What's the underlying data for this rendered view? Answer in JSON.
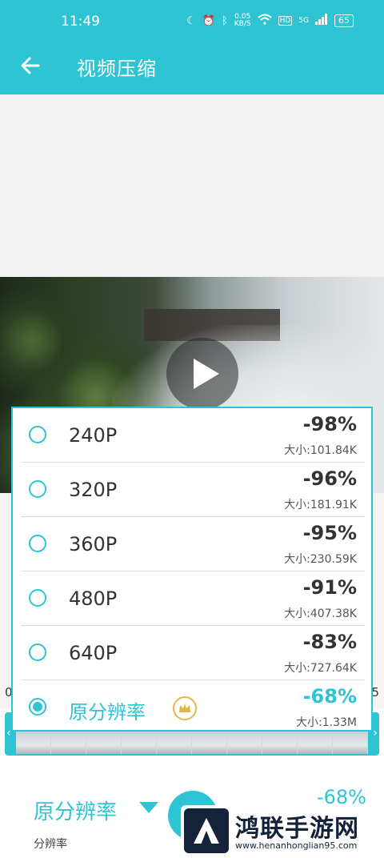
{
  "status_bar": {
    "time": "11:49",
    "network_speed_value": "0.05",
    "network_speed_unit": "KB/S",
    "hd_badge": "HD",
    "signal_badge": "5G",
    "battery": "65",
    "icons": [
      "moon-icon",
      "alarm-icon",
      "bluetooth-icon",
      "wifi-icon",
      "signal-icon"
    ]
  },
  "app_bar": {
    "title": "视频压缩",
    "back_icon": "arrow-left-icon",
    "background": "#2ec4d4"
  },
  "video": {
    "play_icon": "play-icon"
  },
  "timeline": {
    "left_number": "0",
    "right_number": "5",
    "left_handle": "‹",
    "right_handle": "›",
    "frame_count": 10
  },
  "resolution_popup": {
    "options": [
      {
        "label": "240P",
        "percent": "-98%",
        "size": "大小:101.84K",
        "selected": false
      },
      {
        "label": "320P",
        "percent": "-96%",
        "size": "大小:181.91K",
        "selected": false
      },
      {
        "label": "360P",
        "percent": "-95%",
        "size": "大小:230.59K",
        "selected": false
      },
      {
        "label": "480P",
        "percent": "-91%",
        "size": "大小:407.38K",
        "selected": false
      },
      {
        "label": "640P",
        "percent": "-83%",
        "size": "大小:727.64K",
        "selected": false
      },
      {
        "label": "原分辨率",
        "percent": "-68%",
        "size": "大小:1.33M",
        "selected": true,
        "badge_icon": "crown-icon"
      }
    ]
  },
  "bottom_panel": {
    "resolution_value": "原分辨率",
    "resolution_caption": "分辨率",
    "percent": "-68%"
  },
  "watermark": {
    "text": "鸿联手游网",
    "url": "www.henanhonglian95.com"
  },
  "colors": {
    "accent": "#2ec4d4",
    "crown": "#e3b64a",
    "text": "#333333"
  }
}
